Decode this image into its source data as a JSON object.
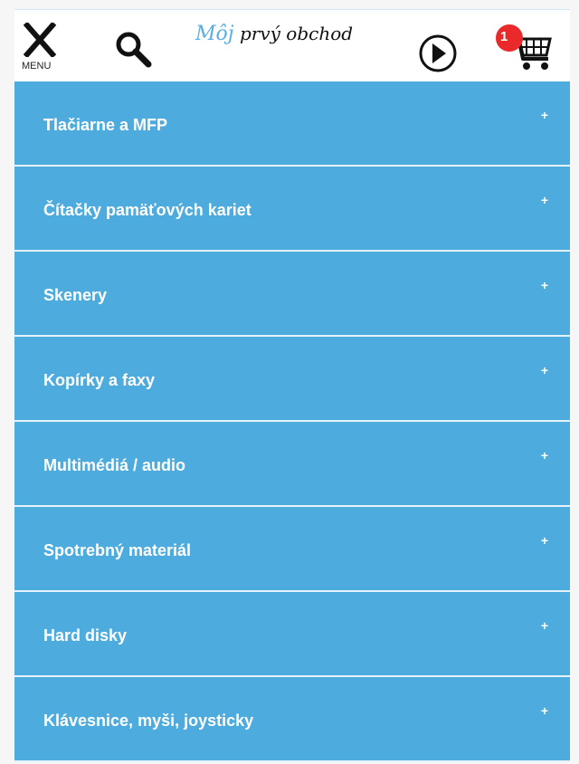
{
  "header": {
    "menu_label": "MENU",
    "logo_prefix": "Môj",
    "logo_text": "prvý obchod",
    "cart_count": "1"
  },
  "icons": {
    "menu": "close-icon",
    "search": "search-icon",
    "next": "arrow-right-circle-icon",
    "cart": "shopping-cart-icon",
    "expand": "plus-icon"
  },
  "colors": {
    "menu_bg": "#4dabde",
    "menu_text": "#ffffff",
    "badge": "#ea2a2a",
    "logo_accent": "#5aaee0"
  },
  "categories": [
    {
      "label": "Tlačiarne a MFP",
      "toggle": "+"
    },
    {
      "label": "Čítačky pamäťových kariet",
      "toggle": "+"
    },
    {
      "label": "Skenery",
      "toggle": "+"
    },
    {
      "label": "Kopírky a faxy",
      "toggle": "+"
    },
    {
      "label": "Multimédiá / audio",
      "toggle": "+"
    },
    {
      "label": "Spotrebný materiál",
      "toggle": "+"
    },
    {
      "label": "Hard disky",
      "toggle": "+"
    },
    {
      "label": "Klávesnice, myši, joysticky",
      "toggle": "+"
    }
  ]
}
